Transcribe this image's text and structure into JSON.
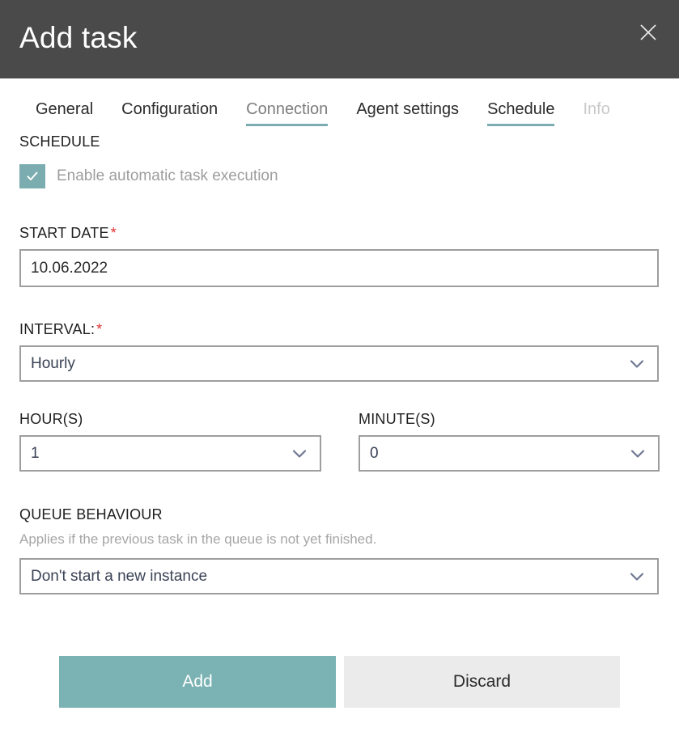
{
  "dialog": {
    "title": "Add task",
    "close_icon": "close-icon"
  },
  "tabs": [
    {
      "label": "General",
      "state": "normal",
      "underlined": false
    },
    {
      "label": "Configuration",
      "state": "normal",
      "underlined": false
    },
    {
      "label": "Connection",
      "state": "muted",
      "underlined": true
    },
    {
      "label": "Agent settings",
      "state": "normal",
      "underlined": false
    },
    {
      "label": "Schedule",
      "state": "normal",
      "underlined": true
    },
    {
      "label": "Info",
      "state": "disabled",
      "underlined": false
    }
  ],
  "schedule": {
    "section_label": "SCHEDULE",
    "enable_checkbox": {
      "label": "Enable automatic task execution",
      "checked": true,
      "icon": "check-icon"
    }
  },
  "start_date": {
    "label": "START DATE",
    "required_marker": "*",
    "value": "10.06.2022"
  },
  "interval": {
    "label": "INTERVAL:",
    "required_marker": "*",
    "value": "Hourly",
    "chevron_icon": "chevron-down-icon"
  },
  "hours": {
    "label": "HOUR(S)",
    "value": "1",
    "chevron_icon": "chevron-down-icon"
  },
  "minutes": {
    "label": "MINUTE(S)",
    "value": "0",
    "chevron_icon": "chevron-down-icon"
  },
  "queue_behaviour": {
    "label": "QUEUE BEHAVIOUR",
    "helper": "Applies if the previous task in the queue is not yet finished.",
    "value": "Don't start a new instance",
    "chevron_icon": "chevron-down-icon"
  },
  "actions": {
    "add_label": "Add",
    "discard_label": "Discard"
  },
  "colors": {
    "accent_teal": "#7bb2b3",
    "header_grey": "#4a4a4a",
    "required_red": "#e03131",
    "field_border": "#9e9e9e",
    "discard_grey": "#ebebeb"
  }
}
